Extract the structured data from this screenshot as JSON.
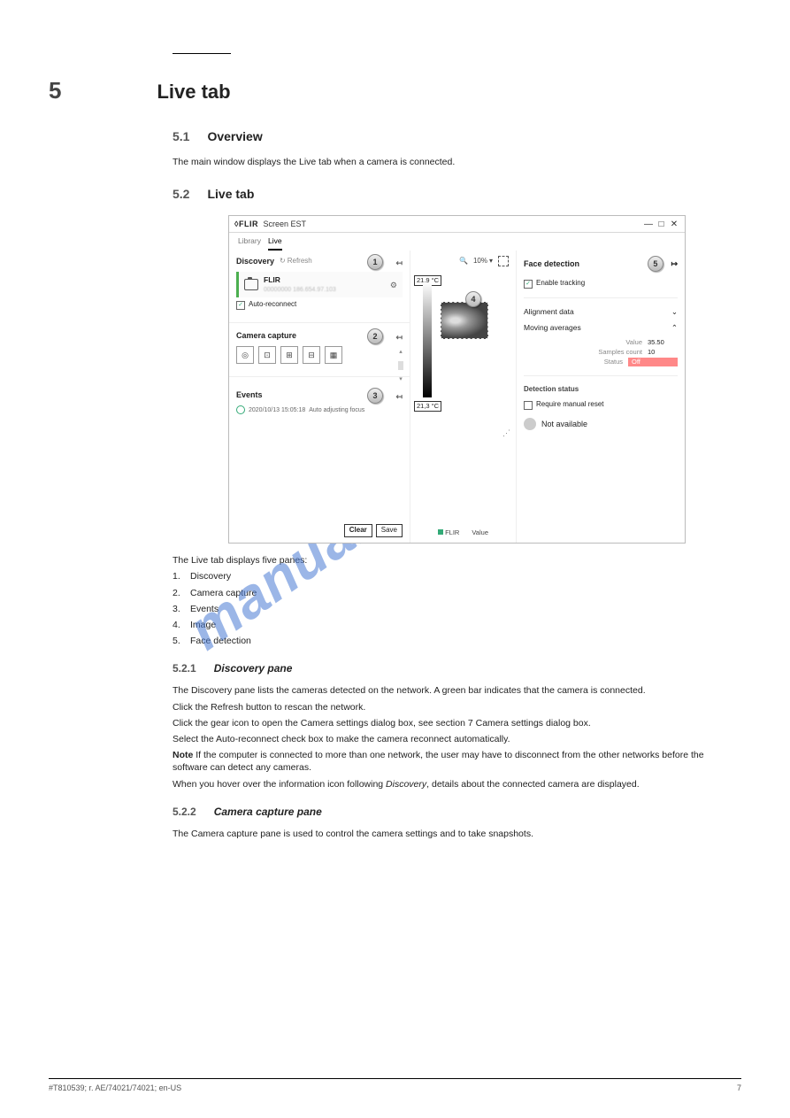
{
  "doc": {
    "chapter_num": "5",
    "title": "Live tab",
    "intro_secnum": "5.1",
    "intro_title": "Overview",
    "intro_text": "The main window displays the Live tab when a camera is connected.",
    "tabname_secnum": "5.2",
    "tabname_title": "Live tab",
    "panes_intro": "The Live tab displays five panes:",
    "panes": [
      {
        "n": "1.",
        "t": "Discovery"
      },
      {
        "n": "2.",
        "t": "Camera capture"
      },
      {
        "n": "3.",
        "t": "Events"
      },
      {
        "n": "4.",
        "t": "Image"
      },
      {
        "n": "5.",
        "t": "Face detection"
      }
    ],
    "disc_secnum": "5.2.1",
    "disc_title": "Discovery pane",
    "disc_text": "The Discovery pane lists the cameras detected on the network. A green bar indicates that the camera is connected.",
    "refresh_text1": "Click the Refresh button to rescan the network.",
    "refresh_text2": "Click the gear icon to open the Camera settings dialog box, see section 7 Camera settings dialog box.",
    "refresh_text3": "Select the Auto-reconnect check box to make the camera reconnect automatically.",
    "note_label": "Note",
    "note_text": "If the computer is connected to more than one network, the user may have to disconnect from the other networks before the software can detect any cameras.",
    "note2_prefix": "When you hover over the information icon following ",
    "note2_italic": "Discovery",
    "note2_suffix": ", details about the connected camera are displayed.",
    "cap_secnum": "5.2.2",
    "cap_title": "Camera capture pane",
    "cap_text": "The Camera capture pane is used to control the camera settings and to take snapshots.",
    "watermark": "manualshive.com",
    "footer_left": "#T810539; r. AE/74021/74021; en-US",
    "footer_right": "7"
  },
  "app": {
    "brand": "◊FLIR",
    "brand_sub": "Screen EST",
    "win": {
      "min": "—",
      "max": "□",
      "close": "✕"
    },
    "tabs": {
      "library": "Library",
      "live": "Live"
    },
    "left": {
      "discovery": "Discovery",
      "refresh_icon": "↻",
      "refresh": "Refresh",
      "collapse": "↤",
      "device_name": "FLIR",
      "device_id": "00000000  186.654.97.103",
      "gear": "⚙",
      "auto_reconnect": "Auto-reconnect",
      "camera_capture": "Camera capture",
      "events": "Events",
      "event_time": "2020/10/13 15:05:18",
      "event_msg": "Auto adjusting focus",
      "clear": "Clear",
      "save": "Save"
    },
    "center": {
      "zoom": "10%",
      "temp_top": "21,9 °C",
      "temp_bottom": "21,3 °C",
      "legend_cam": "FLIR",
      "legend_val": "Value"
    },
    "right": {
      "face_detection": "Face detection",
      "expand": "↦",
      "enable_tracking": "Enable tracking",
      "alignment": "Alignment data",
      "moving_avg": "Moving averages",
      "value_k": "Value",
      "value_v": "35.50",
      "samples_k": "Samples count",
      "samples_v": "10",
      "status_k": "Status",
      "status_v": "Off",
      "det_status": "Detection status",
      "req_reset": "Require manual reset",
      "not_avail": "Not available"
    },
    "callouts": {
      "c1": "1",
      "c2": "2",
      "c3": "3",
      "c4": "4",
      "c5": "5"
    }
  }
}
